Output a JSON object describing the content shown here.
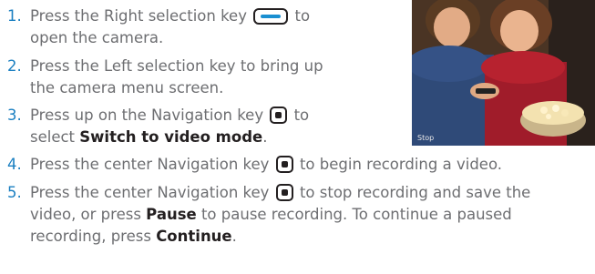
{
  "steps": [
    {
      "num": "1.",
      "parts": [
        "Press the Right selection key ",
        "",
        " to",
        "open the camera."
      ]
    },
    {
      "num": "2.",
      "lines": [
        "Press the Left selection key to bring up",
        "the camera menu screen."
      ]
    },
    {
      "num": "3.",
      "parts": [
        "Press up on the Navigation key ",
        "",
        " to",
        "select ",
        "Switch to video mode",
        "."
      ]
    },
    {
      "num": "4.",
      "parts": [
        "Press the center Navigation key ",
        "",
        " to begin recording a video."
      ]
    },
    {
      "num": "5.",
      "parts": [
        "Press the center Navigation key ",
        "",
        " to stop recording and save the",
        "video, or press ",
        "Pause",
        " to pause recording. To continue a paused",
        "recording, press ",
        "Continue",
        "."
      ]
    }
  ],
  "photo": {
    "caption": "Stop"
  },
  "icons": {
    "right_key": "right-softkey-icon",
    "nav_key": "center-navigation-key-icon"
  }
}
